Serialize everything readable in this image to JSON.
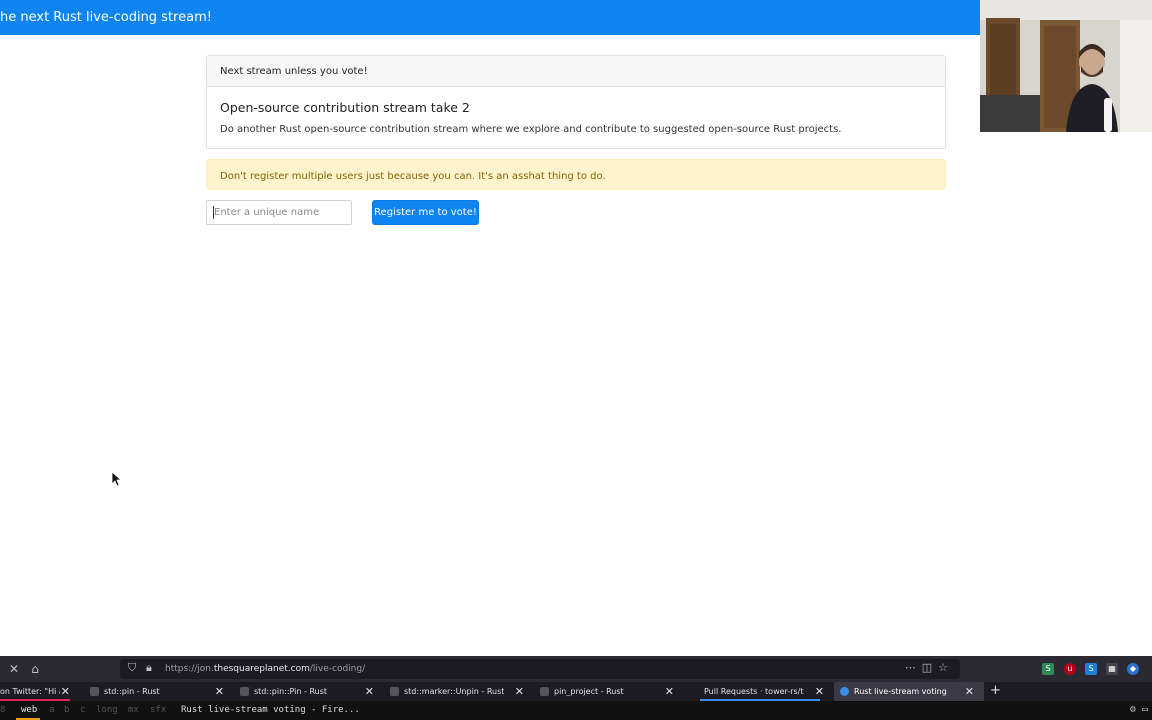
{
  "page": {
    "topbar_title": "he next Rust live-coding stream!",
    "card_header": "Next stream unless you vote!",
    "card_title": "Open-source contribution stream take 2",
    "card_text": "Do another Rust open-source contribution stream where we explore and contribute to suggested open-source Rust projects.",
    "alert_text": "Don't register multiple users just because you can. It's an asshat thing to do.",
    "name_placeholder": "Enter a unique name",
    "register_button": "Register me to vote!"
  },
  "browser": {
    "url_prefix": "https://jon.",
    "url_host": "thesquareplanet.com",
    "url_path": "/live-coding/",
    "tabs": [
      {
        "label": "on Twitter: \"Hi all! I'm"
      },
      {
        "label": "std::pin - Rust"
      },
      {
        "label": "std::pin::Pin - Rust"
      },
      {
        "label": "std::marker::Unpin - Rust"
      },
      {
        "label": "pin_project - Rust"
      },
      {
        "label": "Pull Requests · tower-rs/tower"
      },
      {
        "label": "Rust live-stream voting"
      }
    ],
    "accent_color": "#0d84f0"
  },
  "statusbar": {
    "workspaces": [
      "8",
      "web",
      "a",
      "b",
      "c",
      "long",
      "mx",
      "sfx"
    ],
    "window_title": "Rust live-stream voting - Fire..."
  }
}
